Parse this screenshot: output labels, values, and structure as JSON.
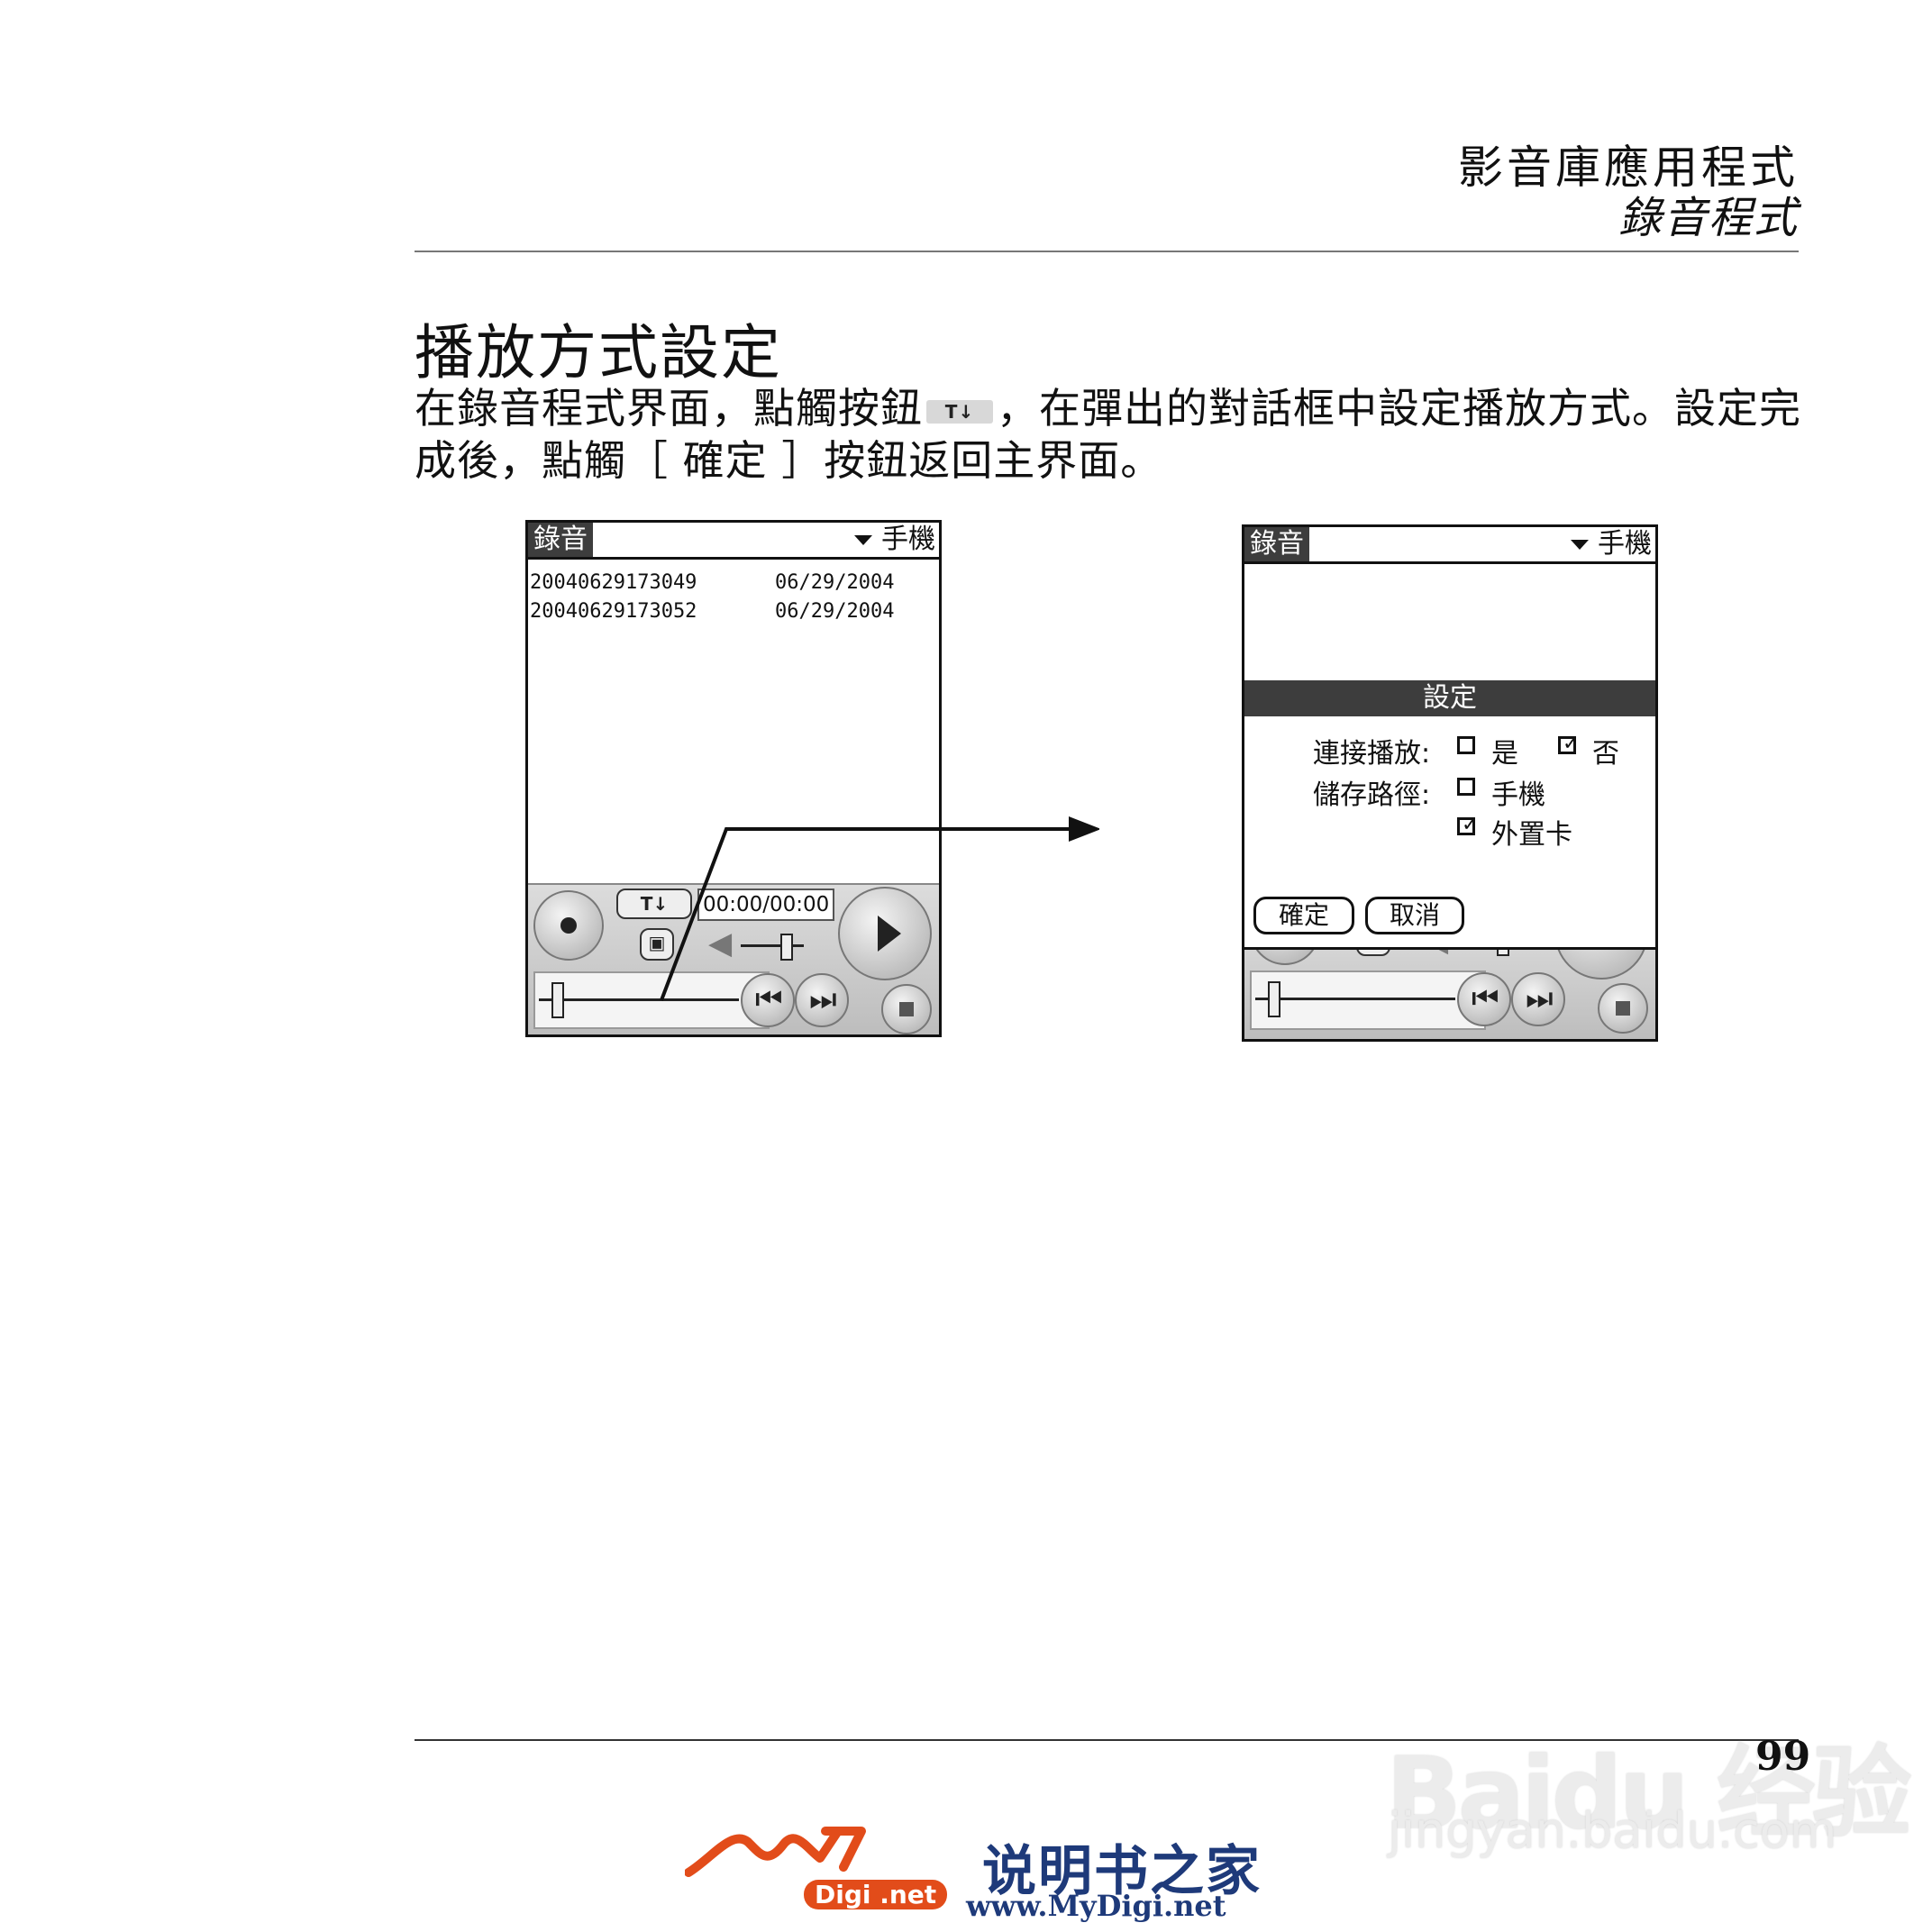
{
  "header": {
    "title": "影音庫應用程式",
    "subtitle": "錄音程式"
  },
  "section": {
    "title": "播放方式設定",
    "body_part1": "在錄音程式界面，點觸按鈕",
    "inline_button": "T↓",
    "body_part2": "，在彈出的對話框中設定播放方式。設定完成後，點觸［ 確定 ］按鈕返回主界面。"
  },
  "screen1": {
    "title": "錄音",
    "storage_dropdown": "手機",
    "recordings": [
      {
        "name": "20040629173049",
        "date": "06/29/2004"
      },
      {
        "name": "20040629173052",
        "date": "06/29/2004"
      }
    ],
    "settings_button": "T↓",
    "time": "00:00/00:00"
  },
  "screen2": {
    "title": "錄音",
    "storage_dropdown": "手機",
    "dialog": {
      "title": "設定",
      "continuous_label": "連接播放:",
      "yes": "是",
      "no": "否",
      "path_label": "儲存路徑:",
      "phone": "手機",
      "card": "外置卡",
      "ok": "確定",
      "cancel": "取消"
    }
  },
  "footer": {
    "page_number": "99"
  },
  "watermark": {
    "brand": "Baidu 经验",
    "url": "jingyan.baidu.com"
  },
  "logo": {
    "net_badge": "Digi .net",
    "name_cn": "说明书之家",
    "url": "www.MyDigi.net"
  },
  "colors": {
    "title_bar": "#3d3d3d",
    "logo_orange": "#e24c1a",
    "logo_blue": "#1e3a7a"
  }
}
